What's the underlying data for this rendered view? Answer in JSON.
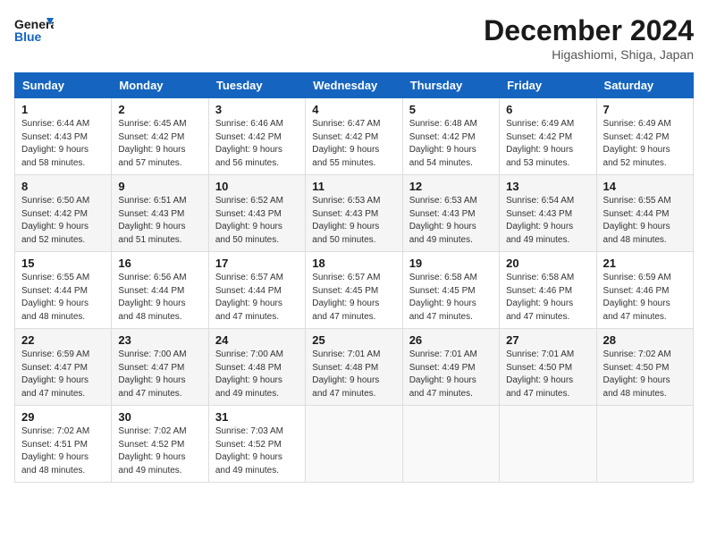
{
  "logo": {
    "line1": "General",
    "line2": "Blue"
  },
  "title": "December 2024",
  "subtitle": "Higashiomi, Shiga, Japan",
  "days_of_week": [
    "Sunday",
    "Monday",
    "Tuesday",
    "Wednesday",
    "Thursday",
    "Friday",
    "Saturday"
  ],
  "weeks": [
    [
      {
        "day": 1,
        "sunrise": "6:44 AM",
        "sunset": "4:43 PM",
        "daylight": "9 hours and 58 minutes."
      },
      {
        "day": 2,
        "sunrise": "6:45 AM",
        "sunset": "4:42 PM",
        "daylight": "9 hours and 57 minutes."
      },
      {
        "day": 3,
        "sunrise": "6:46 AM",
        "sunset": "4:42 PM",
        "daylight": "9 hours and 56 minutes."
      },
      {
        "day": 4,
        "sunrise": "6:47 AM",
        "sunset": "4:42 PM",
        "daylight": "9 hours and 55 minutes."
      },
      {
        "day": 5,
        "sunrise": "6:48 AM",
        "sunset": "4:42 PM",
        "daylight": "9 hours and 54 minutes."
      },
      {
        "day": 6,
        "sunrise": "6:49 AM",
        "sunset": "4:42 PM",
        "daylight": "9 hours and 53 minutes."
      },
      {
        "day": 7,
        "sunrise": "6:49 AM",
        "sunset": "4:42 PM",
        "daylight": "9 hours and 52 minutes."
      }
    ],
    [
      {
        "day": 8,
        "sunrise": "6:50 AM",
        "sunset": "4:42 PM",
        "daylight": "9 hours and 52 minutes."
      },
      {
        "day": 9,
        "sunrise": "6:51 AM",
        "sunset": "4:43 PM",
        "daylight": "9 hours and 51 minutes."
      },
      {
        "day": 10,
        "sunrise": "6:52 AM",
        "sunset": "4:43 PM",
        "daylight": "9 hours and 50 minutes."
      },
      {
        "day": 11,
        "sunrise": "6:53 AM",
        "sunset": "4:43 PM",
        "daylight": "9 hours and 50 minutes."
      },
      {
        "day": 12,
        "sunrise": "6:53 AM",
        "sunset": "4:43 PM",
        "daylight": "9 hours and 49 minutes."
      },
      {
        "day": 13,
        "sunrise": "6:54 AM",
        "sunset": "4:43 PM",
        "daylight": "9 hours and 49 minutes."
      },
      {
        "day": 14,
        "sunrise": "6:55 AM",
        "sunset": "4:44 PM",
        "daylight": "9 hours and 48 minutes."
      }
    ],
    [
      {
        "day": 15,
        "sunrise": "6:55 AM",
        "sunset": "4:44 PM",
        "daylight": "9 hours and 48 minutes."
      },
      {
        "day": 16,
        "sunrise": "6:56 AM",
        "sunset": "4:44 PM",
        "daylight": "9 hours and 48 minutes."
      },
      {
        "day": 17,
        "sunrise": "6:57 AM",
        "sunset": "4:44 PM",
        "daylight": "9 hours and 47 minutes."
      },
      {
        "day": 18,
        "sunrise": "6:57 AM",
        "sunset": "4:45 PM",
        "daylight": "9 hours and 47 minutes."
      },
      {
        "day": 19,
        "sunrise": "6:58 AM",
        "sunset": "4:45 PM",
        "daylight": "9 hours and 47 minutes."
      },
      {
        "day": 20,
        "sunrise": "6:58 AM",
        "sunset": "4:46 PM",
        "daylight": "9 hours and 47 minutes."
      },
      {
        "day": 21,
        "sunrise": "6:59 AM",
        "sunset": "4:46 PM",
        "daylight": "9 hours and 47 minutes."
      }
    ],
    [
      {
        "day": 22,
        "sunrise": "6:59 AM",
        "sunset": "4:47 PM",
        "daylight": "9 hours and 47 minutes."
      },
      {
        "day": 23,
        "sunrise": "7:00 AM",
        "sunset": "4:47 PM",
        "daylight": "9 hours and 47 minutes."
      },
      {
        "day": 24,
        "sunrise": "7:00 AM",
        "sunset": "4:48 PM",
        "daylight": "9 hours and 49 minutes."
      },
      {
        "day": 25,
        "sunrise": "7:01 AM",
        "sunset": "4:48 PM",
        "daylight": "9 hours and 47 minutes."
      },
      {
        "day": 26,
        "sunrise": "7:01 AM",
        "sunset": "4:49 PM",
        "daylight": "9 hours and 47 minutes."
      },
      {
        "day": 27,
        "sunrise": "7:01 AM",
        "sunset": "4:50 PM",
        "daylight": "9 hours and 47 minutes."
      },
      {
        "day": 28,
        "sunrise": "7:02 AM",
        "sunset": "4:50 PM",
        "daylight": "9 hours and 48 minutes."
      }
    ],
    [
      {
        "day": 29,
        "sunrise": "7:02 AM",
        "sunset": "4:51 PM",
        "daylight": "9 hours and 48 minutes."
      },
      {
        "day": 30,
        "sunrise": "7:02 AM",
        "sunset": "4:52 PM",
        "daylight": "9 hours and 49 minutes."
      },
      {
        "day": 31,
        "sunrise": "7:03 AM",
        "sunset": "4:52 PM",
        "daylight": "9 hours and 49 minutes."
      },
      null,
      null,
      null,
      null
    ]
  ]
}
